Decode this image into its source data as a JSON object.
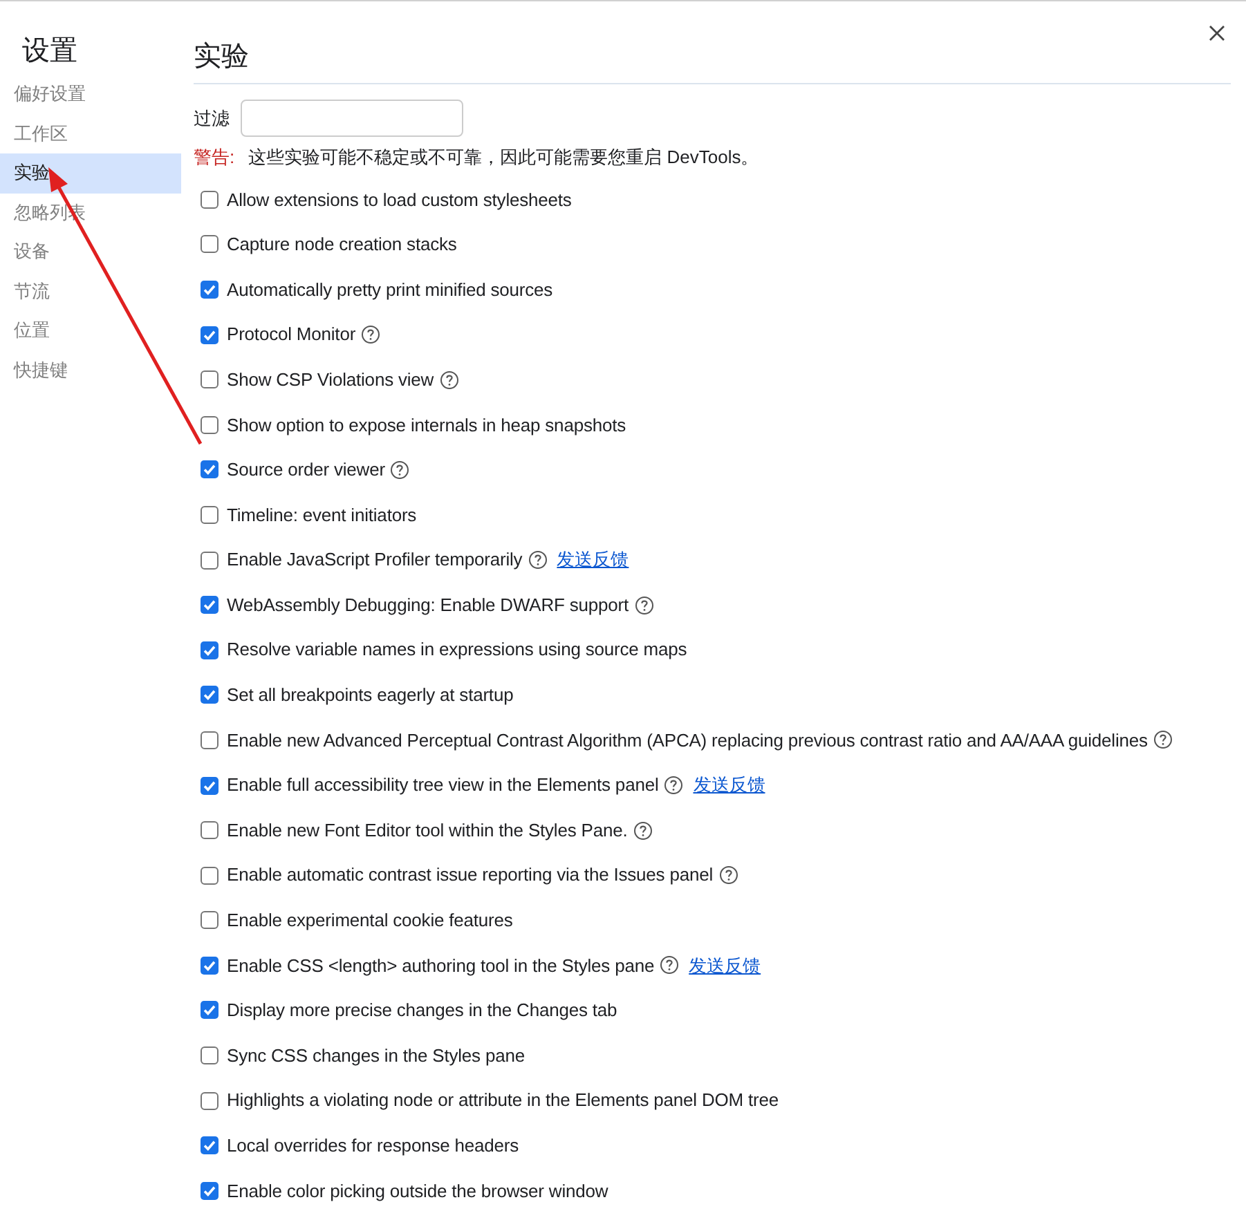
{
  "sidebar": {
    "title": "设置",
    "items": [
      {
        "label": "偏好设置",
        "selected": false
      },
      {
        "label": "工作区",
        "selected": false
      },
      {
        "label": "实验",
        "selected": true
      },
      {
        "label": "忽略列表",
        "selected": false
      },
      {
        "label": "设备",
        "selected": false
      },
      {
        "label": "节流",
        "selected": false
      },
      {
        "label": "位置",
        "selected": false
      },
      {
        "label": "快捷键",
        "selected": false
      }
    ]
  },
  "panel": {
    "title": "实验",
    "filter": {
      "label": "过滤"
    },
    "warning": {
      "label": "警告:",
      "text": "这些实验可能不稳定或不可靠，因此可能需要您重启 DevTools。"
    },
    "experiments": [
      {
        "label": "Allow extensions to load custom stylesheets",
        "checked": false,
        "help": false
      },
      {
        "label": "Capture node creation stacks",
        "checked": false,
        "help": false
      },
      {
        "label": "Automatically pretty print minified sources",
        "checked": true,
        "help": false
      },
      {
        "label": "Protocol Monitor",
        "checked": true,
        "help": true
      },
      {
        "label": "Show CSP Violations view",
        "checked": false,
        "help": true
      },
      {
        "label": "Show option to expose internals in heap snapshots",
        "checked": false,
        "help": false
      },
      {
        "label": "Source order viewer",
        "checked": true,
        "help": true
      },
      {
        "label": "Timeline: event initiators",
        "checked": false,
        "help": false
      },
      {
        "label": "Enable JavaScript Profiler temporarily",
        "checked": false,
        "help": true,
        "link": "发送反馈"
      },
      {
        "label": "WebAssembly Debugging: Enable DWARF support",
        "checked": true,
        "help": true
      },
      {
        "label": "Resolve variable names in expressions using source maps",
        "checked": true,
        "help": false
      },
      {
        "label": "Set all breakpoints eagerly at startup",
        "checked": true,
        "help": false
      },
      {
        "label": "Enable new Advanced Perceptual Contrast Algorithm (APCA) replacing previous contrast ratio and AA/AAA guidelines",
        "checked": false,
        "help": true
      },
      {
        "label": "Enable full accessibility tree view in the Elements panel",
        "checked": true,
        "help": true,
        "link": "发送反馈"
      },
      {
        "label": "Enable new Font Editor tool within the Styles Pane.",
        "checked": false,
        "help": true
      },
      {
        "label": "Enable automatic contrast issue reporting via the Issues panel",
        "checked": false,
        "help": true
      },
      {
        "label": "Enable experimental cookie features",
        "checked": false,
        "help": false
      },
      {
        "label": "Enable CSS <length> authoring tool in the Styles pane",
        "checked": true,
        "help": true,
        "link": "发送反馈"
      },
      {
        "label": "Display more precise changes in the Changes tab",
        "checked": true,
        "help": false
      },
      {
        "label": "Sync CSS changes in the Styles pane",
        "checked": false,
        "help": false
      },
      {
        "label": "Highlights a violating node or attribute in the Elements panel DOM tree",
        "checked": false,
        "help": false
      },
      {
        "label": "Local overrides for response headers",
        "checked": true,
        "help": false
      },
      {
        "label": "Enable color picking outside the browser window",
        "checked": true,
        "help": false
      }
    ]
  }
}
